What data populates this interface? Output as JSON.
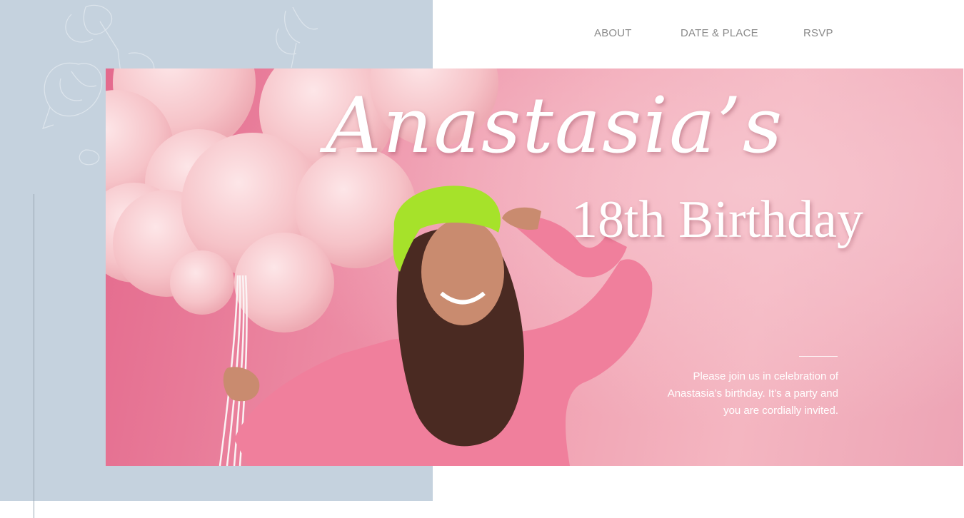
{
  "nav": {
    "items": [
      {
        "label": "ABOUT"
      },
      {
        "label": "DATE & PLACE"
      },
      {
        "label": "RSVP"
      }
    ]
  },
  "hero": {
    "title_script": "Anastasia’s",
    "subtitle": "18th Birthday",
    "invite_text": "Please join us in celebration of Anastasia’s birthday. It’s a party and you are cordially invited."
  },
  "colors": {
    "side_panel": "#c5d2de",
    "hero_pink": "#f1a4b4",
    "nav_text": "#8a8a8a",
    "beret_green": "#a6e22a",
    "sweater_pink": "#f07f9c"
  }
}
